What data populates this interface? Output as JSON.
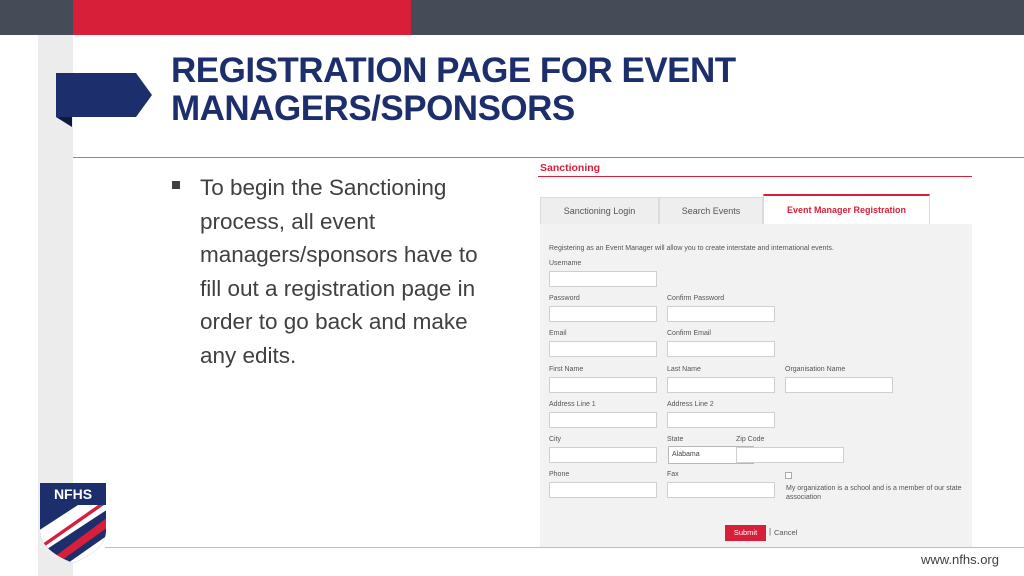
{
  "slide": {
    "title_line1": "REGISTRATION PAGE FOR EVENT",
    "title_line2": "MANAGERS/SPONSORS",
    "bullet": "To begin the Sanctioning process, all event managers/sponsors have to fill out a registration page in order to go back and make any edits.",
    "footer_url": "www.nfhs.org",
    "logo_text": "NFHS",
    "colors": {
      "navy": "#1c2e6b",
      "red": "#d71f3a",
      "dark_bar": "#454c58"
    }
  },
  "screenshot": {
    "section_title": "Sanctioning",
    "tabs": [
      "Sanctioning Login",
      "Search Events",
      "Event Manager Registration"
    ],
    "active_tab": "Event Manager Registration",
    "intro": "Registering as an Event Manager will allow you to create interstate and international events.",
    "labels": {
      "username": "Username",
      "password": "Password",
      "confirm_password": "Confirm Password",
      "email": "Email",
      "confirm_email": "Confirm Email",
      "first_name": "First Name",
      "last_name": "Last Name",
      "organisation_name": "Organisation Name",
      "address1": "Address Line 1",
      "address2": "Address Line 2",
      "city": "City",
      "state": "State",
      "zip": "Zip Code",
      "phone": "Phone",
      "fax": "Fax"
    },
    "state_value": "Alabama",
    "checkbox_label": "My organization is a school and is a member of our state association",
    "submit_label": "Submit",
    "separator": "|",
    "cancel_label": "Cancel"
  }
}
